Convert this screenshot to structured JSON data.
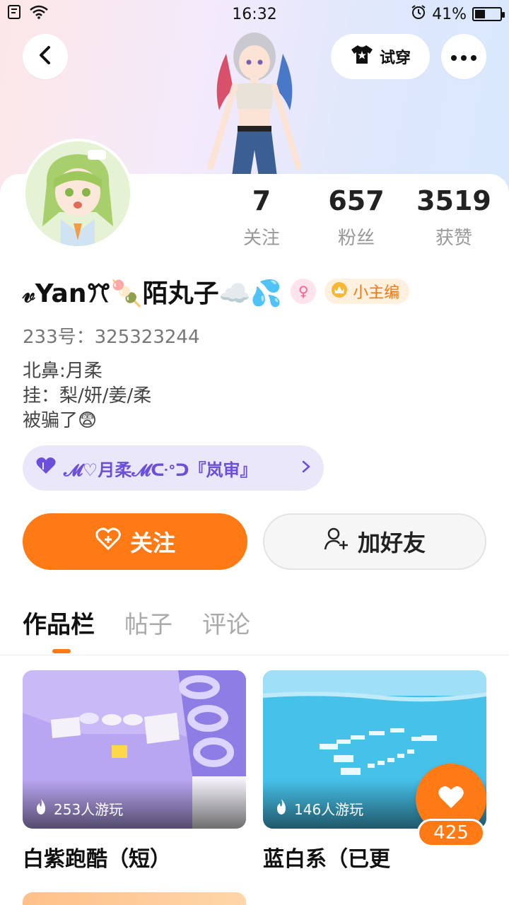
{
  "status_bar": {
    "time": "16:32",
    "battery": "41%",
    "battery_level": 0.41
  },
  "top_bar": {
    "try_on_label": "试穿"
  },
  "stats": [
    {
      "value": "7",
      "label": "关注"
    },
    {
      "value": "657",
      "label": "粉丝"
    },
    {
      "value": "3519",
      "label": "获赞"
    }
  ],
  "profile": {
    "name": "𝓋Yanꔫ🍡陌丸子☁️💦",
    "gender": "female",
    "gender_symbol": "♀",
    "role_badge": "小主编",
    "uid": "233号：325323244",
    "bio_lines": [
      "北鼻:月柔",
      "挂：梨/妍/姜/柔",
      "被骗了😨"
    ]
  },
  "group": {
    "label": "𝓜♡月柔𝓜ᑢᐤᑐ『岚审』"
  },
  "actions": {
    "follow": "关注",
    "add_friend": "加好友"
  },
  "tabs": [
    "作品栏",
    "帖子",
    "评论"
  ],
  "works": [
    {
      "title": "白紫跑酷（短）",
      "plays": "253人游玩"
    },
    {
      "title": "蓝白系（已更",
      "plays": "146人游玩"
    }
  ],
  "like_count": "425",
  "colors": {
    "accent": "#ff7a14",
    "group_text": "#6b4fd8",
    "group_bg": "#ebe7fb"
  }
}
